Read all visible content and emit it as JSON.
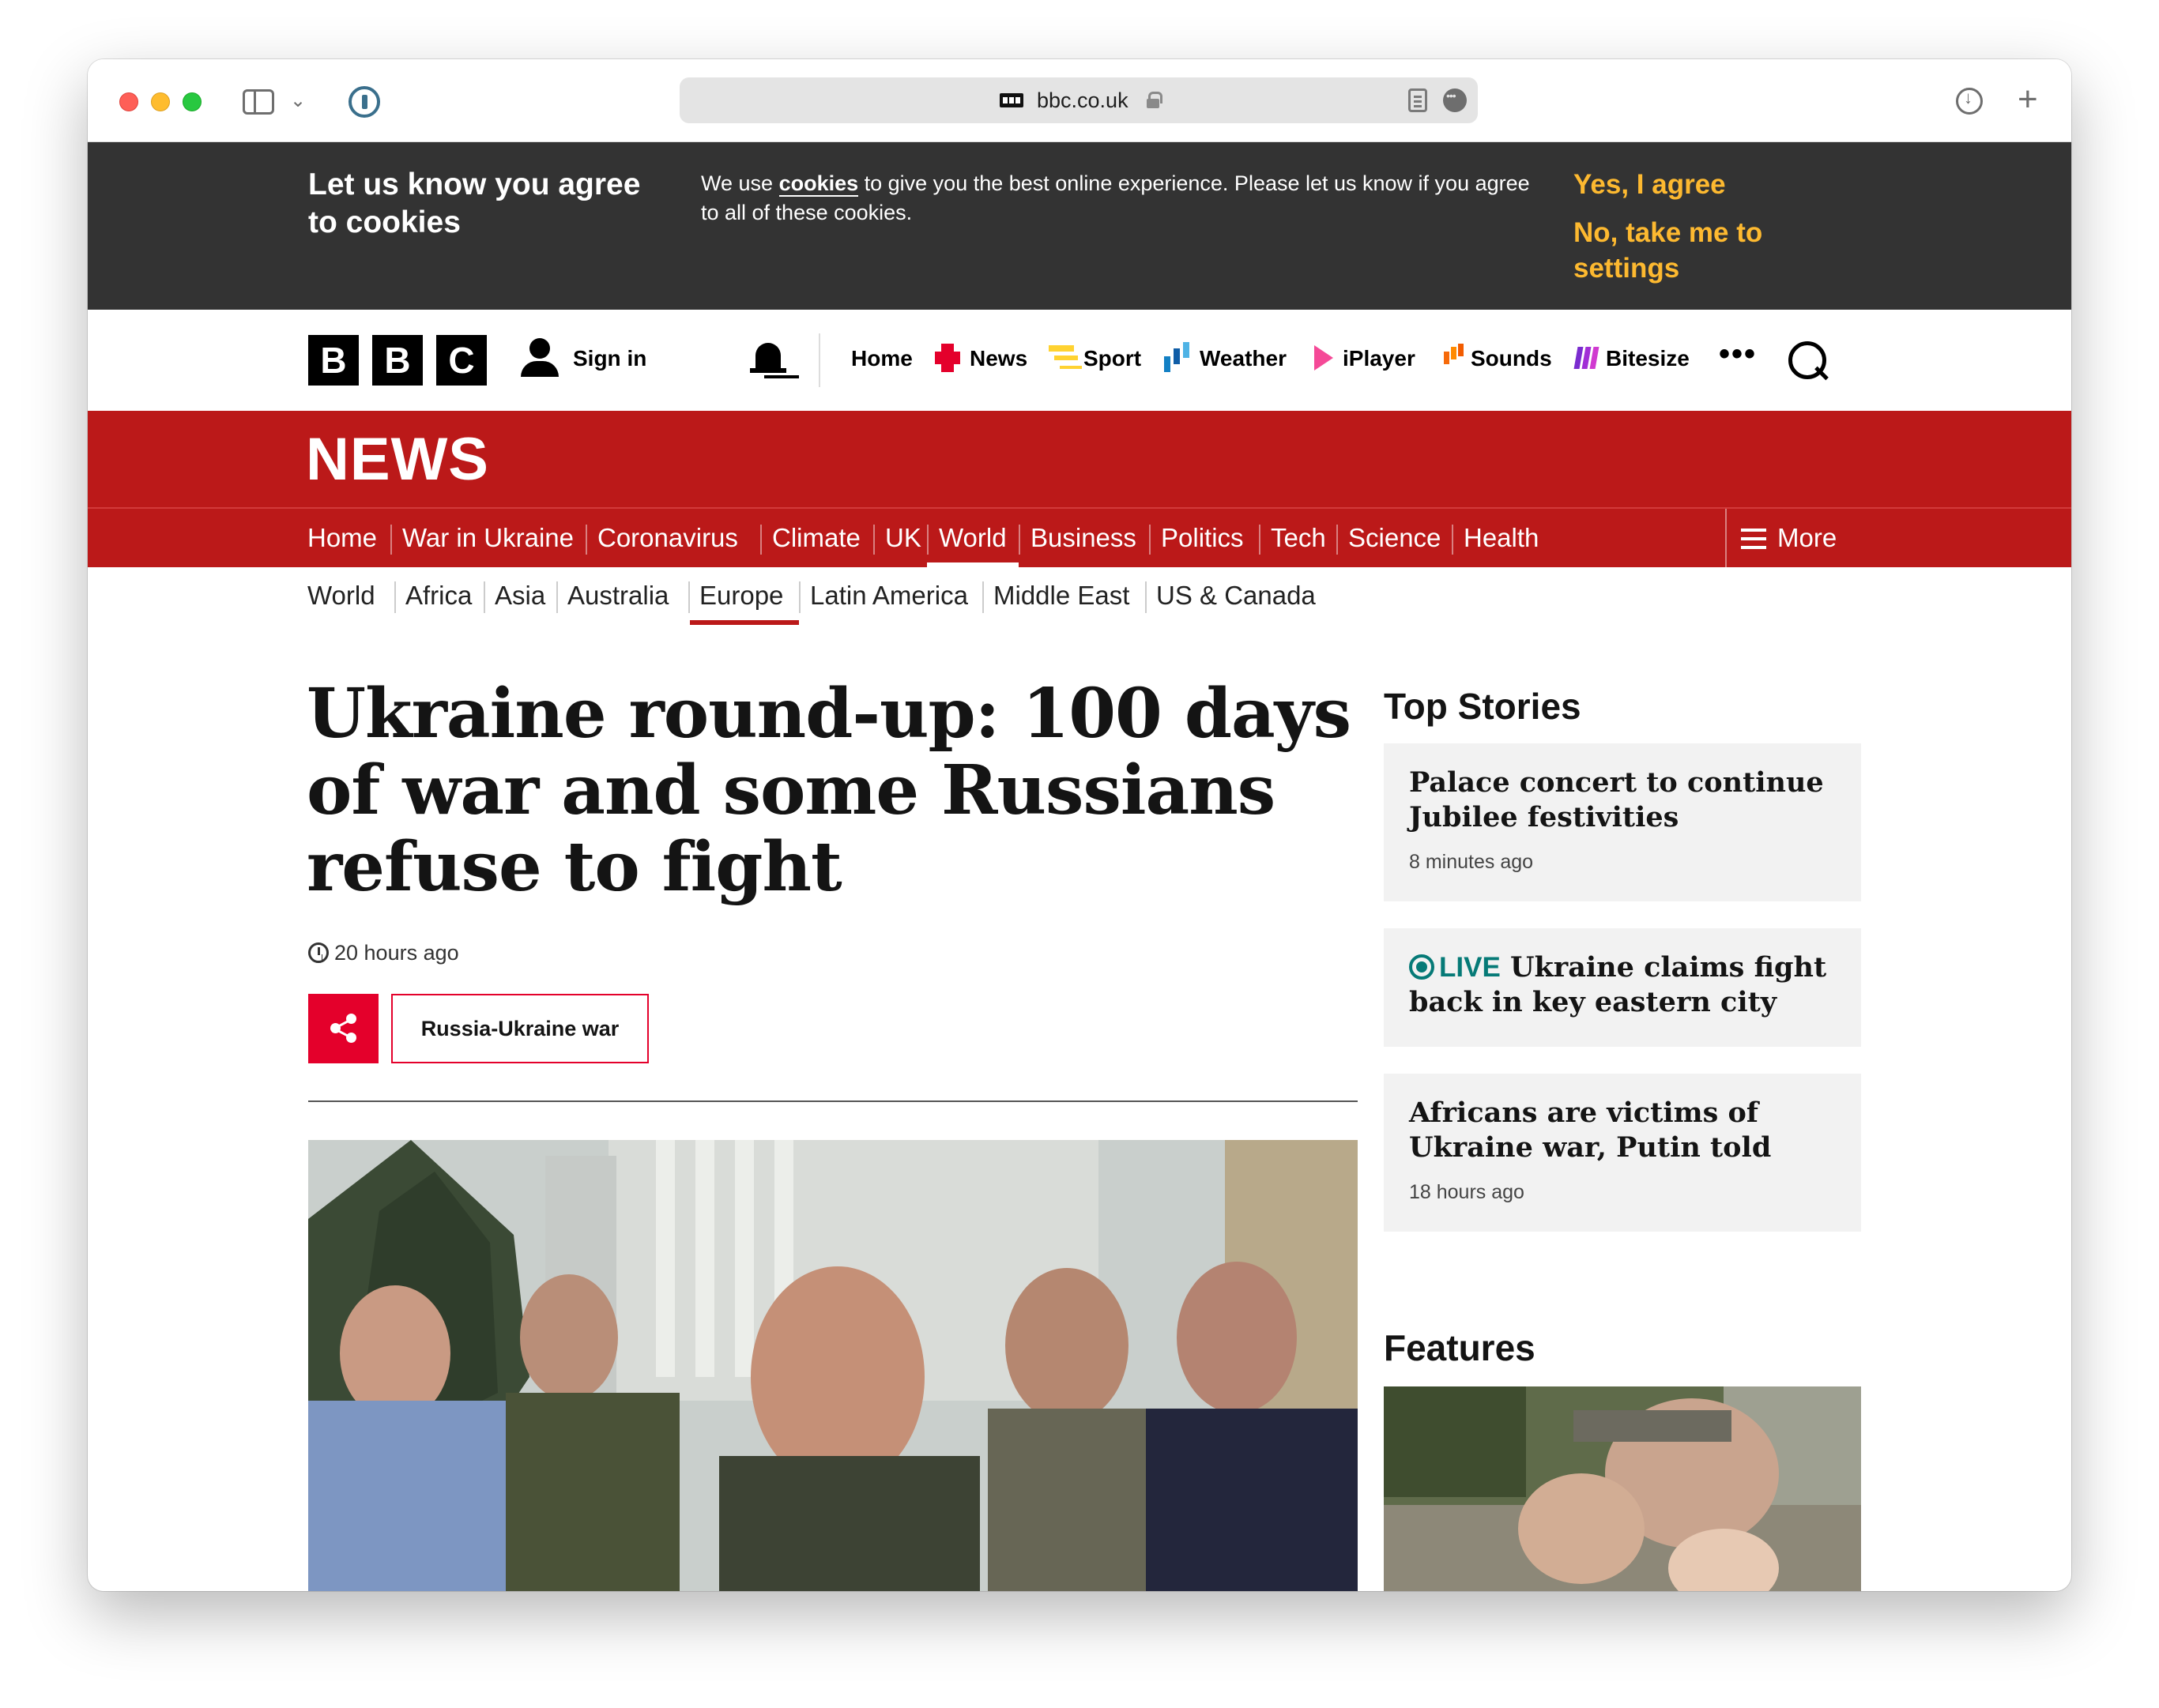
{
  "browser": {
    "url": "bbc.co.uk"
  },
  "cookie_banner": {
    "title": "Let us know you agree to cookies",
    "text_prefix": "We use ",
    "text_link": "cookies",
    "text_suffix": " to give you the best online experience. Please let us know if you agree to all of these cookies.",
    "agree": "Yes, I agree",
    "settings": "No, take me to settings",
    "accent_color": "#fdb930"
  },
  "masthead": {
    "logo": [
      "B",
      "B",
      "C"
    ],
    "sign_in": "Sign in",
    "nav": [
      "Home",
      "News",
      "Sport",
      "Weather",
      "iPlayer",
      "Sounds",
      "Bitesize"
    ],
    "more": "•••"
  },
  "news": {
    "logo": "NEWS",
    "brand_color": "#bb1919",
    "nav": [
      "Home",
      "War in Ukraine",
      "Coronavirus",
      "Climate",
      "UK",
      "World",
      "Business",
      "Politics",
      "Tech",
      "Science",
      "Health"
    ],
    "active": "World",
    "more": "More",
    "subnav": [
      "World",
      "Africa",
      "Asia",
      "Australia",
      "Europe",
      "Latin America",
      "Middle East",
      "US & Canada"
    ],
    "subnav_active": "Europe"
  },
  "article": {
    "headline": "Ukraine round-up: 100 days of war and some Russians refuse to fight",
    "time": "20 hours ago",
    "topic": "Russia-Ukraine war"
  },
  "sidebar": {
    "top_stories_heading": "Top Stories",
    "stories": [
      {
        "title": "Palace concert to continue Jubilee festivities",
        "time": "8 minutes ago"
      },
      {
        "live": "LIVE",
        "title": "Ukraine claims fight back in key eastern city"
      },
      {
        "title": "Africans are victims of Ukraine war, Putin told",
        "time": "18 hours ago"
      }
    ],
    "features_heading": "Features"
  }
}
